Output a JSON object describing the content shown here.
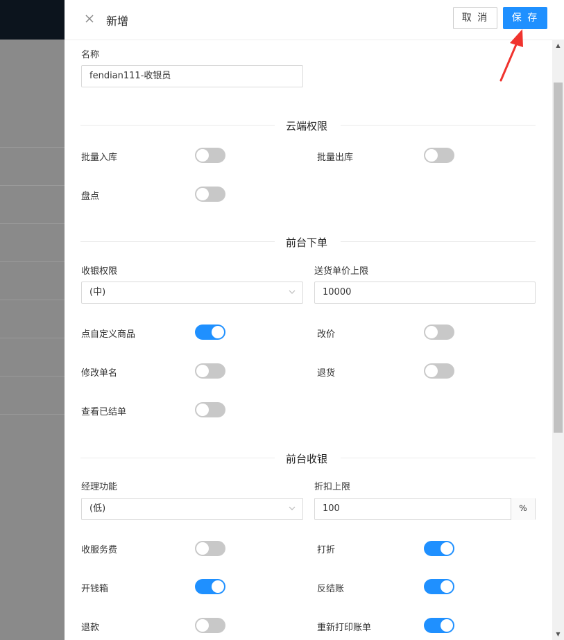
{
  "header": {
    "title": "新增",
    "cancel_label": "取 消",
    "save_label": "保 存"
  },
  "name_field": {
    "label": "名称",
    "value": "fendian111-收银员"
  },
  "sections": {
    "cloud": "云端权限",
    "front_order": "前台下单",
    "front_cashier": "前台收银"
  },
  "cloud": {
    "batch_in": {
      "label": "批量入库",
      "on": false
    },
    "batch_out": {
      "label": "批量出库",
      "on": false
    },
    "inventory": {
      "label": "盘点",
      "on": false
    }
  },
  "front_order": {
    "cashier_perm": {
      "label": "收银权限",
      "value": "(中)"
    },
    "delivery_limit": {
      "label": "送货单价上限",
      "value": "10000"
    },
    "custom_goods": {
      "label": "点自定义商品",
      "on": true
    },
    "change_price": {
      "label": "改价",
      "on": false
    },
    "rename_order": {
      "label": "修改单名",
      "on": false
    },
    "return_goods": {
      "label": "退货",
      "on": false
    },
    "view_settled": {
      "label": "查看已结单",
      "on": false
    }
  },
  "front_cashier": {
    "manager_func": {
      "label": "经理功能",
      "value": "(低)"
    },
    "discount_limit": {
      "label": "折扣上限",
      "value": "100",
      "unit": "%"
    },
    "service_fee": {
      "label": "收服务费",
      "on": false
    },
    "discount": {
      "label": "打折",
      "on": true
    },
    "open_drawer": {
      "label": "开钱箱",
      "on": true
    },
    "reverse_settle": {
      "label": "反结账",
      "on": true
    },
    "refund": {
      "label": "退款",
      "on": false
    },
    "reprint_bill": {
      "label": "重新打印账单",
      "on": true
    }
  },
  "colors": {
    "primary": "#1f90ff",
    "switch_off": "#c8c8c8",
    "annotation_arrow": "#f0332e"
  }
}
